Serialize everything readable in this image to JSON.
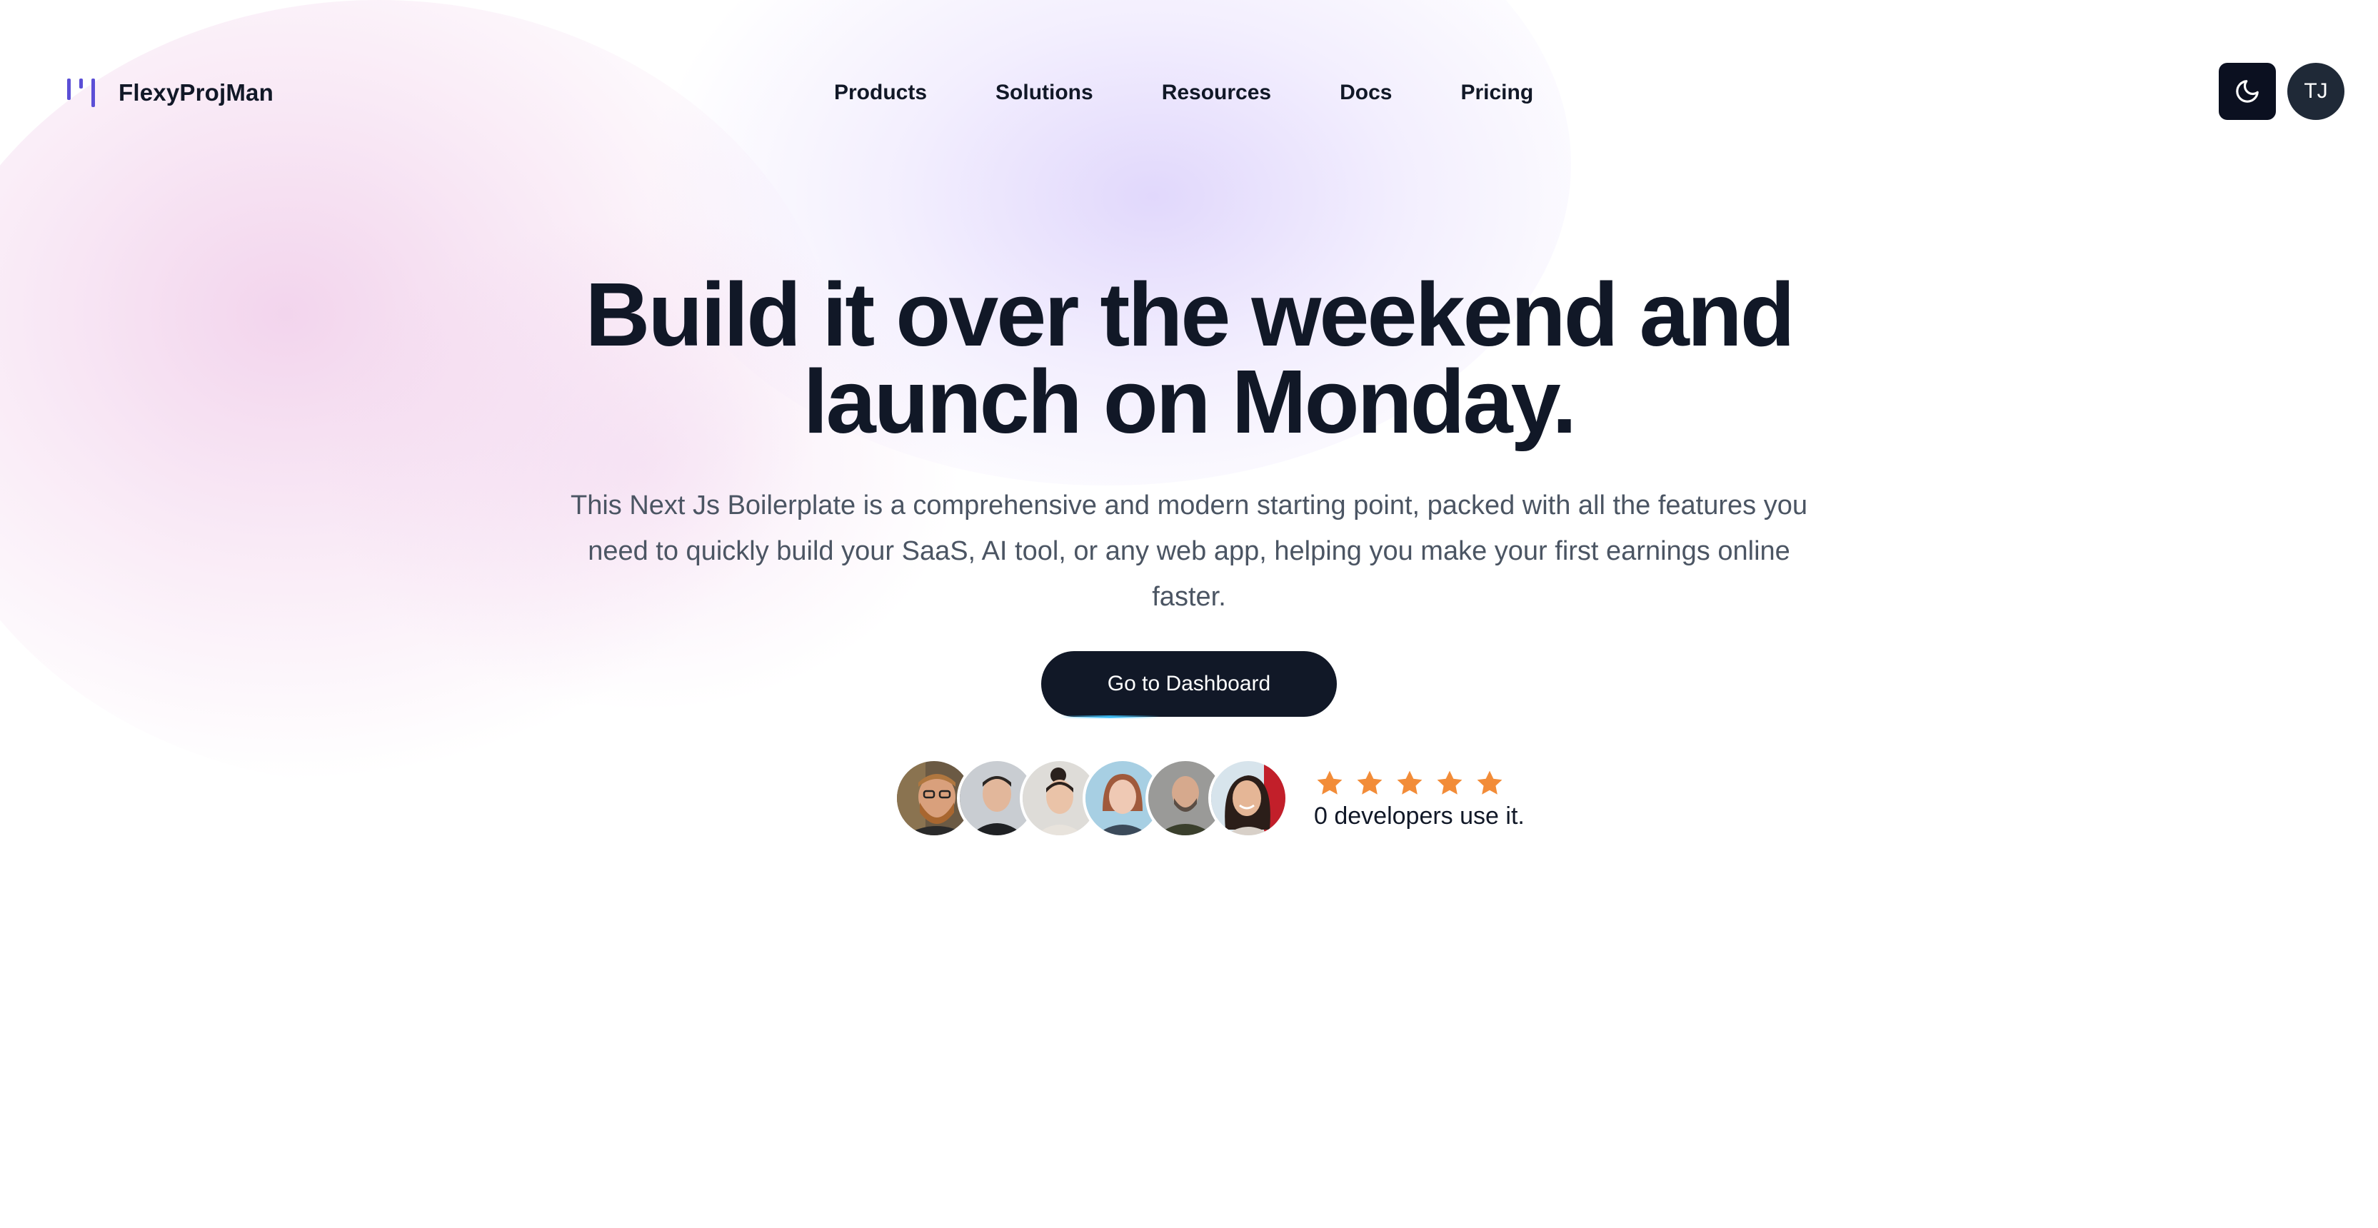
{
  "brand": {
    "name": "FlexyProjMan",
    "logo_icon": "bars-logo-icon",
    "accent": "#5b4fd6"
  },
  "nav": {
    "items": [
      {
        "label": "Products"
      },
      {
        "label": "Solutions"
      },
      {
        "label": "Resources"
      },
      {
        "label": "Docs"
      },
      {
        "label": "Pricing"
      }
    ]
  },
  "header_actions": {
    "theme_toggle_icon": "moon-icon",
    "user_initials": "TJ"
  },
  "hero": {
    "title_line1": "Build it over the weekend and",
    "title_line2": "launch on Monday.",
    "subtitle": "This Next Js Boilerplate is a comprehensive and modern starting point, packed with all the features you need to quickly build your SaaS, AI tool, or any web app, helping you make your first earnings online faster.",
    "cta_label": "Go to Dashboard"
  },
  "social_proof": {
    "avatar_count": 6,
    "rating_stars": 5,
    "star_color": "#f28c38",
    "text": "0 developers use it."
  },
  "colors": {
    "primary_dark": "#111827",
    "muted_text": "#4b5563",
    "toggle_bg": "#0b1020"
  }
}
